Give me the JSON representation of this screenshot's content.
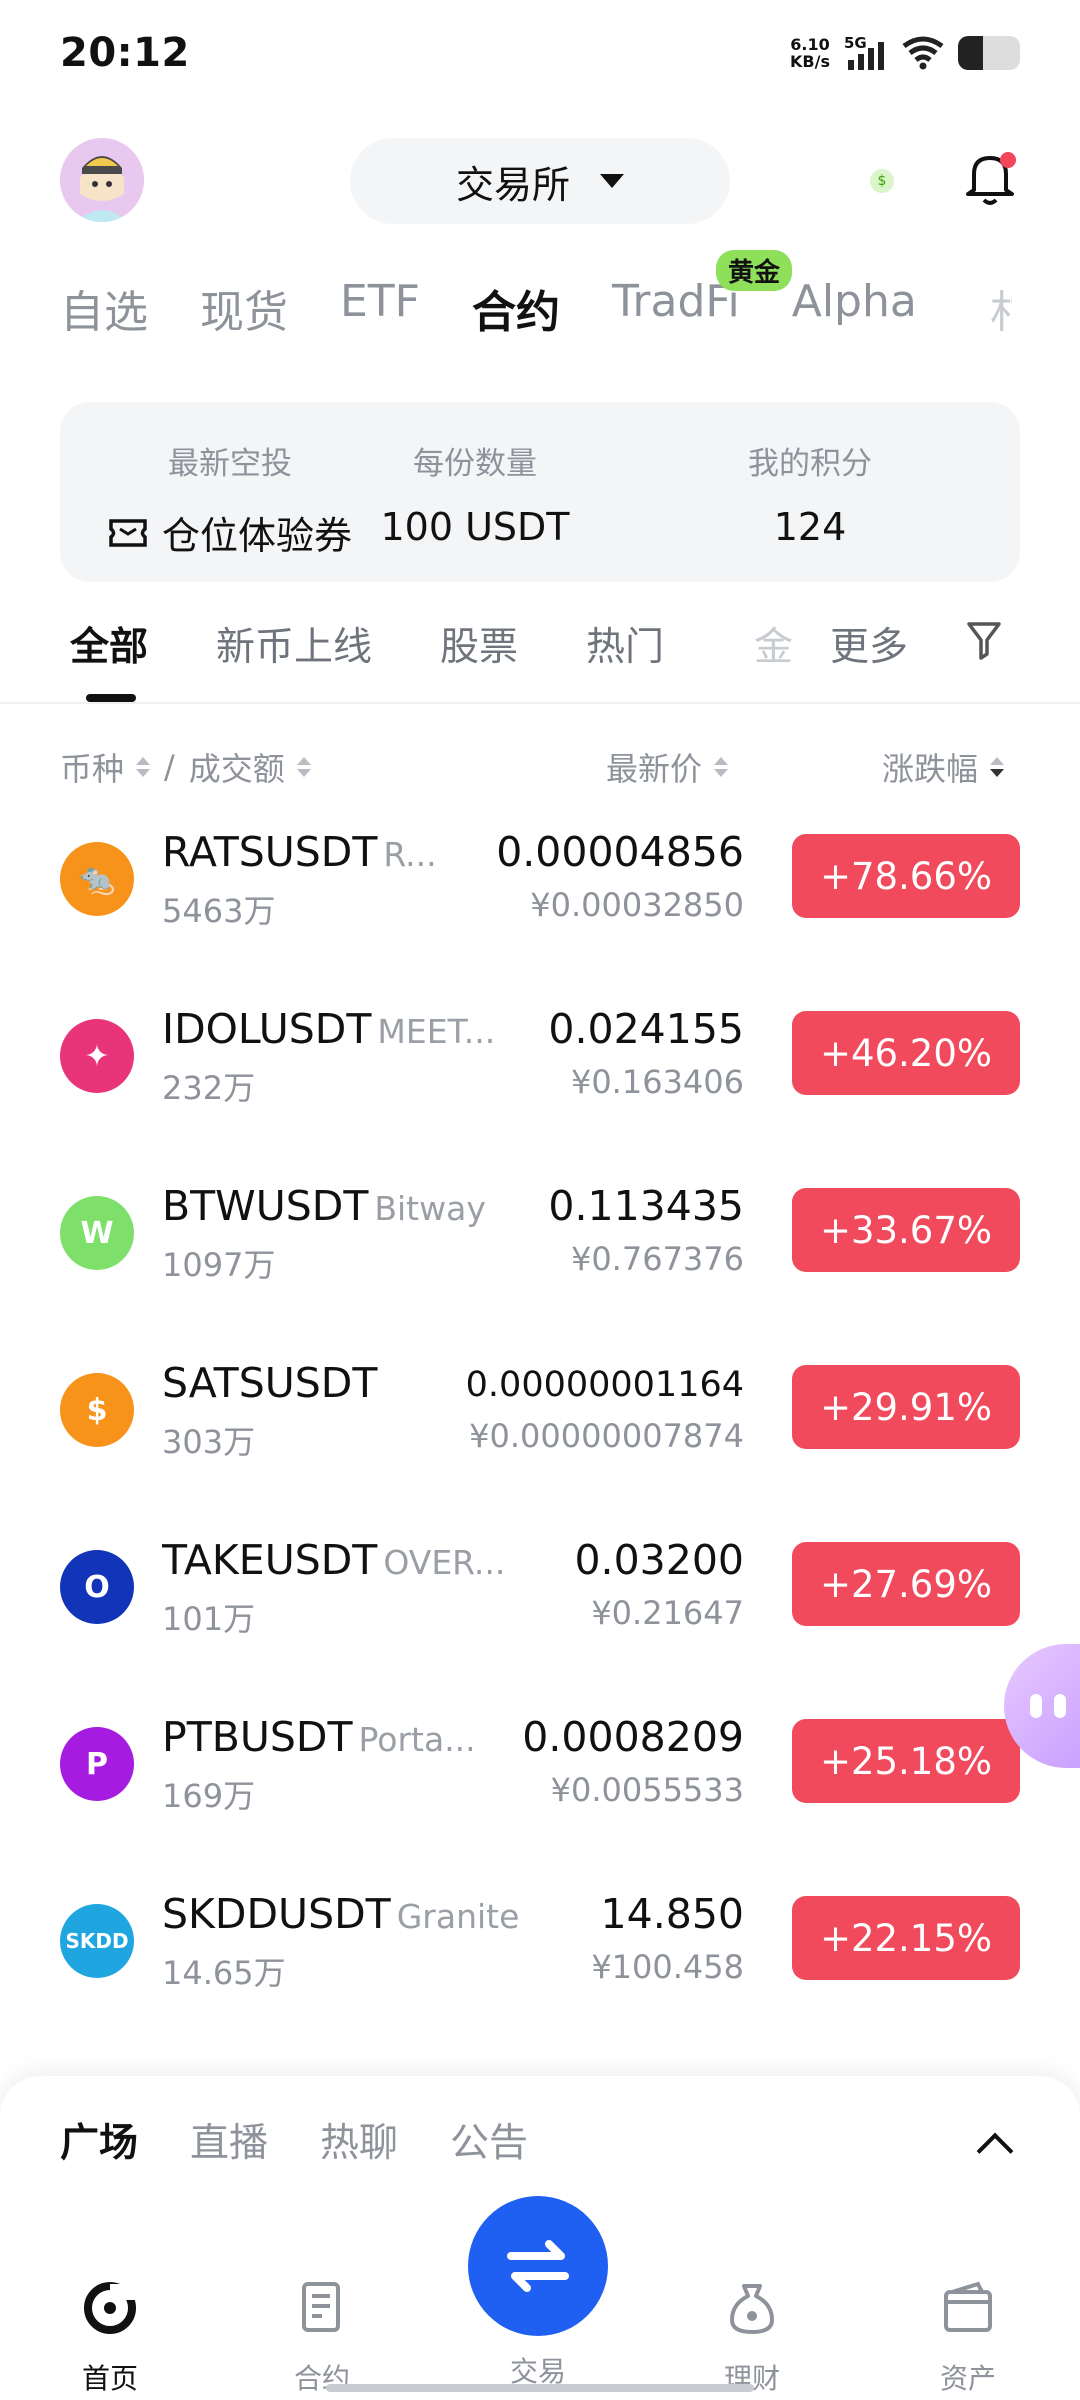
{
  "status_bar": {
    "time": "20:12",
    "net_speed_value": "6.10",
    "net_speed_unit": "KB/s",
    "signal_label": "5G",
    "battery_level": 0.4
  },
  "header": {
    "exchange_label": "交易所"
  },
  "category_tabs": {
    "items": [
      {
        "label": "自选"
      },
      {
        "label": "现货"
      },
      {
        "label": "ETF"
      },
      {
        "label": "合约",
        "active": true
      },
      {
        "label": "TradFi"
      },
      {
        "label": "Alpha"
      }
    ],
    "gold_badge": "黄金",
    "cut_label": "村"
  },
  "airdrop": {
    "latest_label": "最新空投",
    "latest_value": "仓位体验券",
    "qty_label": "每份数量",
    "qty_value": "100 USDT",
    "points_label": "我的积分",
    "points_value": "124"
  },
  "filter_tabs": {
    "items": [
      {
        "label": "全部",
        "active": true
      },
      {
        "label": "新币上线"
      },
      {
        "label": "股票"
      },
      {
        "label": "热门"
      }
    ],
    "faded": "金",
    "more": "更多"
  },
  "list_header": {
    "coin": "币种",
    "sep": "/",
    "turnover": "成交额",
    "price": "最新价",
    "change": "涨跌幅"
  },
  "rows": [
    {
      "symbol": "RATSUSDT",
      "name": "R...",
      "volume": "5463万",
      "price": "0.00004856",
      "cny": "¥0.00032850",
      "change": "+78.66%",
      "icon_bg": "#f7931a",
      "icon_text": "🐀"
    },
    {
      "symbol": "IDOLUSDT",
      "name": "MEET...",
      "volume": "232万",
      "price": "0.024155",
      "cny": "¥0.163406",
      "change": "+46.20%",
      "icon_bg": "#e8357a",
      "icon_text": "✦"
    },
    {
      "symbol": "BTWUSDT",
      "name": "Bitway",
      "volume": "1097万",
      "price": "0.113435",
      "cny": "¥0.767376",
      "change": "+33.67%",
      "icon_bg": "#7ee06a",
      "icon_text": "W"
    },
    {
      "symbol": "SATSUSDT",
      "name": "",
      "volume": "303万",
      "price": "0.00000001164",
      "cny": "¥0.00000007874",
      "change": "+29.91%",
      "icon_bg": "#f7931a",
      "icon_text": "$"
    },
    {
      "symbol": "TAKEUSDT",
      "name": "OVER...",
      "volume": "101万",
      "price": "0.03200",
      "cny": "¥0.21647",
      "change": "+27.69%",
      "icon_bg": "#1234b8",
      "icon_text": "O"
    },
    {
      "symbol": "PTBUSDT",
      "name": "Porta...",
      "volume": "169万",
      "price": "0.0008209",
      "cny": "¥0.0055533",
      "change": "+25.18%",
      "icon_bg": "#a61be0",
      "icon_text": "P"
    },
    {
      "symbol": "SKDDUSDT",
      "name": "Granite...",
      "volume": "14.65万",
      "price": "14.850",
      "cny": "¥100.458",
      "change": "+22.15%",
      "icon_bg": "#1fa6e0",
      "icon_text": "SKDD"
    }
  ],
  "feed_tabs": {
    "items": [
      {
        "label": "广场",
        "active": true
      },
      {
        "label": "直播"
      },
      {
        "label": "热聊"
      },
      {
        "label": "公告"
      }
    ]
  },
  "bottom_nav": {
    "home": "首页",
    "futures": "合约",
    "trade": "交易",
    "earn": "理财",
    "assets": "资产"
  },
  "colors": {
    "up": "#f04a5c",
    "primary": "#1f5ff2",
    "badge": "#8ee05a"
  }
}
